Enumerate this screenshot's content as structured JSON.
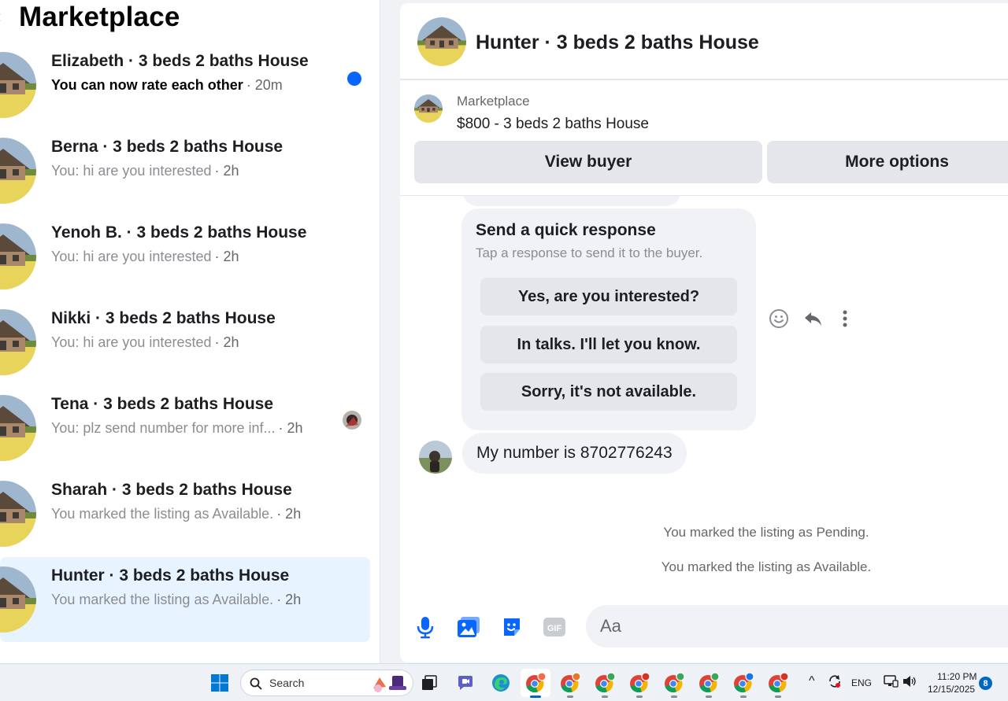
{
  "sidebar": {
    "title": "Marketplace",
    "conversations": [
      {
        "title": "Elizabeth · 3 beds 2 baths House",
        "preview": "You can now rate each other",
        "time": "· 20m",
        "unread": true
      },
      {
        "title": "Berna · 3 beds 2 baths House",
        "preview": "You: hi are you interested",
        "time": "· 2h"
      },
      {
        "title": "Yenoh B. · 3 beds 2 baths House",
        "preview": "You: hi are you interested",
        "time": "· 2h"
      },
      {
        "title": "Nikki · 3 beds 2 baths House",
        "preview": "You: hi are you interested",
        "time": "· 2h"
      },
      {
        "title": "Tena · 3 beds 2 baths House",
        "preview": "You: plz send number for more inf...",
        "time": "· 2h",
        "seen": true
      },
      {
        "title": "Sharah · 3 beds 2 baths House",
        "preview": "You marked the listing as Available.",
        "time": "· 2h"
      },
      {
        "title": "Hunter · 3 beds 2 baths House",
        "preview": "You marked the listing as Available.",
        "time": "· 2h",
        "selected": true
      }
    ]
  },
  "chat": {
    "title": "Hunter · 3 beds 2 baths House",
    "listing": {
      "source": "Marketplace",
      "price_title": "$800 - 3 beds 2 baths House",
      "view_buyer": "View buyer",
      "more_options": "More options"
    },
    "quick_response": {
      "title": "Send a quick response",
      "subtitle": "Tap a response to send it to the buyer.",
      "options": [
        "Yes, are you interested?",
        "In talks. I'll let you know.",
        "Sorry, it's not available."
      ]
    },
    "buyer_message": "My number is 8702776243",
    "system_messages": [
      "You marked the listing as Pending.",
      "You marked the listing as Available."
    ],
    "composer_placeholder": "Aa",
    "icons": [
      "smile-icon",
      "reply-icon",
      "more-vertical-icon",
      "microphone-icon",
      "photo-icon",
      "sticker-icon",
      "gif-icon"
    ]
  },
  "taskbar": {
    "search_label": "Search",
    "language": "ENG",
    "time": "11:20 PM",
    "date": "12/15/2025",
    "notification_count": "8"
  },
  "colors": {
    "accent": "#0866ff",
    "selected_row": "#e7f3ff",
    "bubble": "#f0f2f5",
    "button": "#e4e6eb"
  }
}
